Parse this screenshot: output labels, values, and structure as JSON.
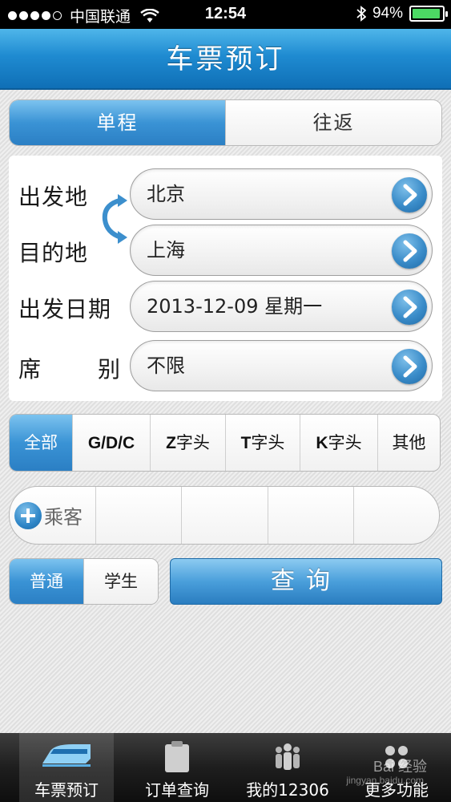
{
  "status_bar": {
    "carrier": "中国联通",
    "time": "12:54",
    "battery": "94%",
    "battery_level": 0.94
  },
  "header": {
    "title": "车票预订"
  },
  "trip_type": {
    "options": [
      "单程",
      "往返"
    ],
    "selected": "单程"
  },
  "form": {
    "from": {
      "label": "出发地",
      "value": "北京"
    },
    "to": {
      "label": "目的地",
      "value": "上海"
    },
    "date": {
      "label": "出发日期",
      "value": "2013-12-09 星期一"
    },
    "seat": {
      "label1": "席",
      "label2": "别",
      "value": "不限"
    }
  },
  "train_types": {
    "all": "全部",
    "gdc": "G/D/C",
    "z_letter": "Z",
    "z_suffix": "字头",
    "t_letter": "T",
    "t_suffix": "字头",
    "k_letter": "K",
    "k_suffix": "字头",
    "other": "其他",
    "selected": "全部"
  },
  "passengers": {
    "add_label": "乘客"
  },
  "passenger_type": {
    "options": [
      "普通",
      "学生"
    ],
    "selected": "普通"
  },
  "search_label": "查询",
  "tab_bar": {
    "tabs": [
      "车票预订",
      "订单查询",
      "我的12306",
      "更多功能"
    ],
    "selected": "车票预订"
  },
  "watermark": {
    "text": "Bai 经验",
    "sub": "jingyan.baidu.com"
  },
  "colors": {
    "accent": "#2b7fc4",
    "header": "#1f8bd1"
  }
}
